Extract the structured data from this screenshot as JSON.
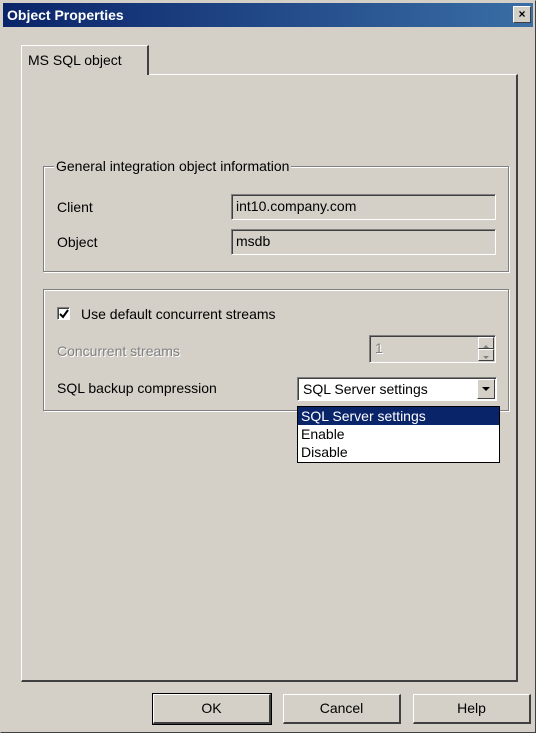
{
  "window": {
    "title": "Object Properties",
    "close_glyph": "×"
  },
  "tabs": [
    {
      "label": "MS SQL object",
      "active": true
    }
  ],
  "general_group": {
    "title": "General integration object information",
    "client_label": "Client",
    "client_value": "int10.company.com",
    "object_label": "Object",
    "object_value": "msdb"
  },
  "streams_group": {
    "use_default_label": "Use default concurrent streams",
    "use_default_checked": true,
    "concurrent_label": "Concurrent streams",
    "concurrent_value": "1",
    "compression_label": "SQL backup compression",
    "compression_selected": "SQL Server settings",
    "compression_options": [
      "SQL Server settings",
      "Enable",
      "Disable"
    ]
  },
  "buttons": {
    "ok": "OK",
    "cancel": "Cancel",
    "help": "Help"
  },
  "colors": {
    "titlebar_start": "#0a246a",
    "titlebar_end": "#3a6ea5",
    "face": "#d4d0c8",
    "selection": "#0a246a"
  },
  "icons": {
    "close": "close-icon",
    "check": "check-icon",
    "dropdown": "chevron-down-icon",
    "spin_up": "arrow-up-icon",
    "spin_down": "arrow-down-icon"
  }
}
